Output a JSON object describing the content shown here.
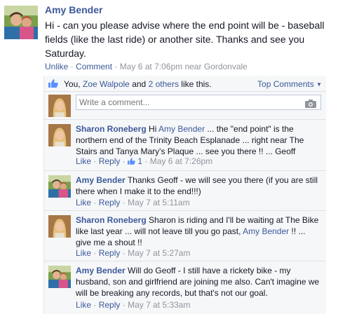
{
  "post": {
    "author": "Amy Bender",
    "text": "Hi - can you please advise where the end point will be - baseball fields (like the last ride) or another site. Thanks and see you Saturday.",
    "like_label": "Unlike",
    "comment_label": "Comment",
    "timestamp": "May 6 at 7:06pm near Gordonvale"
  },
  "likes": {
    "you": "You,",
    "person": "Zoe Walpole",
    "and": "and",
    "others": "2 others",
    "suffix": "like this.",
    "sort_label": "Top Comments"
  },
  "composer": {
    "placeholder": "Write a comment..."
  },
  "comments": [
    {
      "author": "Sharon Roneberg",
      "text_before": "Hi",
      "mention": "Amy Bender",
      "text_after": "... the \"end point\" is the northern end of the Trinity Beach Esplanade ... right near The Stairs and Tanya Mary's Plaque ... see you there !! ... Geoff",
      "like_label": "Like",
      "reply_label": "Reply",
      "like_count": "1",
      "timestamp": "May 6 at 7:26pm"
    },
    {
      "author": "Amy Bender",
      "text": "Thanks Geoff - we will see you there (if you are still there when I make it to the end!!!)",
      "like_label": "Like",
      "reply_label": "Reply",
      "timestamp": "May 7 at 5:11am"
    },
    {
      "author": "Sharon Roneberg",
      "text_before": "Sharon is riding and I'll be waiting at The Bike like last year ... will not leave till you go past,",
      "mention": "Amy Bender",
      "text_after": "!! ... give me a shout !!",
      "like_label": "Like",
      "reply_label": "Reply",
      "timestamp": "May 7 at 5:27am"
    },
    {
      "author": "Amy Bender",
      "text": "Will do Geoff - I still have a rickety bike - my husband, son and girlfriend are joining me also. Can't imagine we will be breaking any records, but that's not our goal.",
      "like_label": "Like",
      "reply_label": "Reply",
      "timestamp": "May 7 at 5:33am"
    }
  ],
  "colors": {
    "link": "#3b5998",
    "muted": "#90949c",
    "panel": "#f6f7f9"
  },
  "icons": [
    "like-thumb-icon",
    "camera-icon",
    "chevron-down-icon"
  ]
}
